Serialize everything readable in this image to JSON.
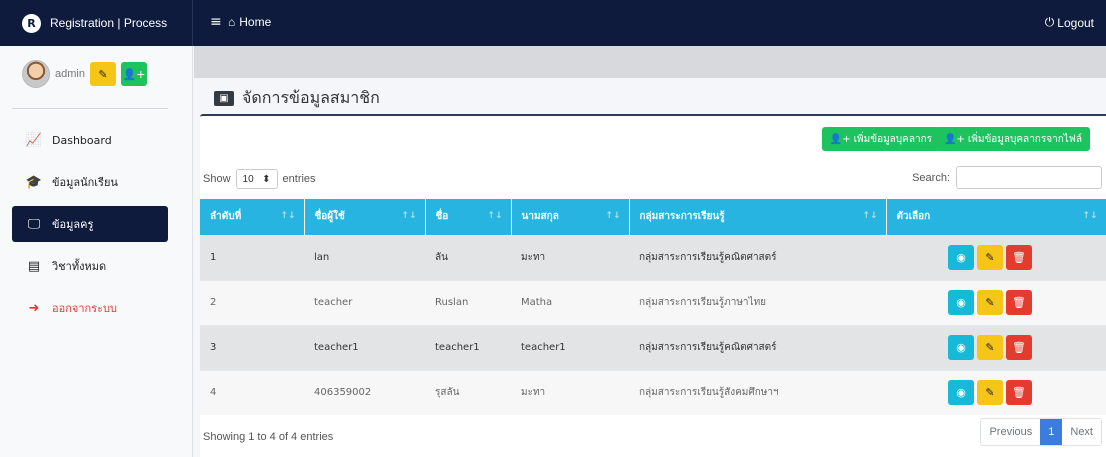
{
  "topbar": {
    "brand": "Registration | Process",
    "home": "Home",
    "logout": "Logout"
  },
  "sidebar": {
    "user": "admin",
    "items": [
      {
        "label": "Dashboard",
        "icon": "chart-line-icon"
      },
      {
        "label": "ข้อมูลนักเรียน",
        "icon": "student-icon"
      },
      {
        "label": "ข้อมูลครู",
        "icon": "teacher-board-icon",
        "active": true
      },
      {
        "label": "วิชาทั้งหมด",
        "icon": "book-icon"
      },
      {
        "label": "ออกจากระบบ",
        "icon": "sign-out-icon",
        "color": "#e33b2e"
      }
    ]
  },
  "page": {
    "title": "จัดการข้อมูลสมาชิก"
  },
  "toolbar": {
    "add_teacher": "เพิ่มข้อมูลบุคลากร",
    "add_from_file": "เพิ่มข้อมูลบุคลากรจากไฟล์"
  },
  "table": {
    "show_label": "Show",
    "entries_value": "10",
    "entries_label": "entries",
    "search_label": "Search:",
    "columns": [
      "ลำดับที่",
      "ชื่อผู้ใช้",
      "ชื่อ",
      "นามสกุล",
      "กลุ่มสาระการเรียนรู้",
      "ตัวเลือก"
    ],
    "rows": [
      {
        "no": "1",
        "username": "lan",
        "first": "ลัน",
        "last": "มะทา",
        "group": "กลุ่มสาระการเรียนรู้คณิตศาสตร์"
      },
      {
        "no": "2",
        "username": "teacher",
        "first": "Ruslan",
        "last": "Matha",
        "group": "กลุ่มสาระการเรียนรู้ภาษาไทย"
      },
      {
        "no": "3",
        "username": "teacher1",
        "first": "teacher1",
        "last": "teacher1",
        "group": "กลุ่มสาระการเรียนรู้คณิตศาสตร์"
      },
      {
        "no": "4",
        "username": "406359002",
        "first": "รุสลัน",
        "last": "มะทา",
        "group": "กลุ่มสาระการเรียนรู้สังคมศึกษาฯ"
      }
    ],
    "info": "Showing 1 to 4 of 4 entries",
    "pagination": {
      "previous": "Previous",
      "current": "1",
      "next": "Next"
    }
  },
  "colors": {
    "navy": "#0e1b3d",
    "table_header": "#27b4e0",
    "success": "#1ec35f",
    "warning": "#f5c518",
    "danger": "#e33b2e",
    "info": "#17b9d9"
  }
}
